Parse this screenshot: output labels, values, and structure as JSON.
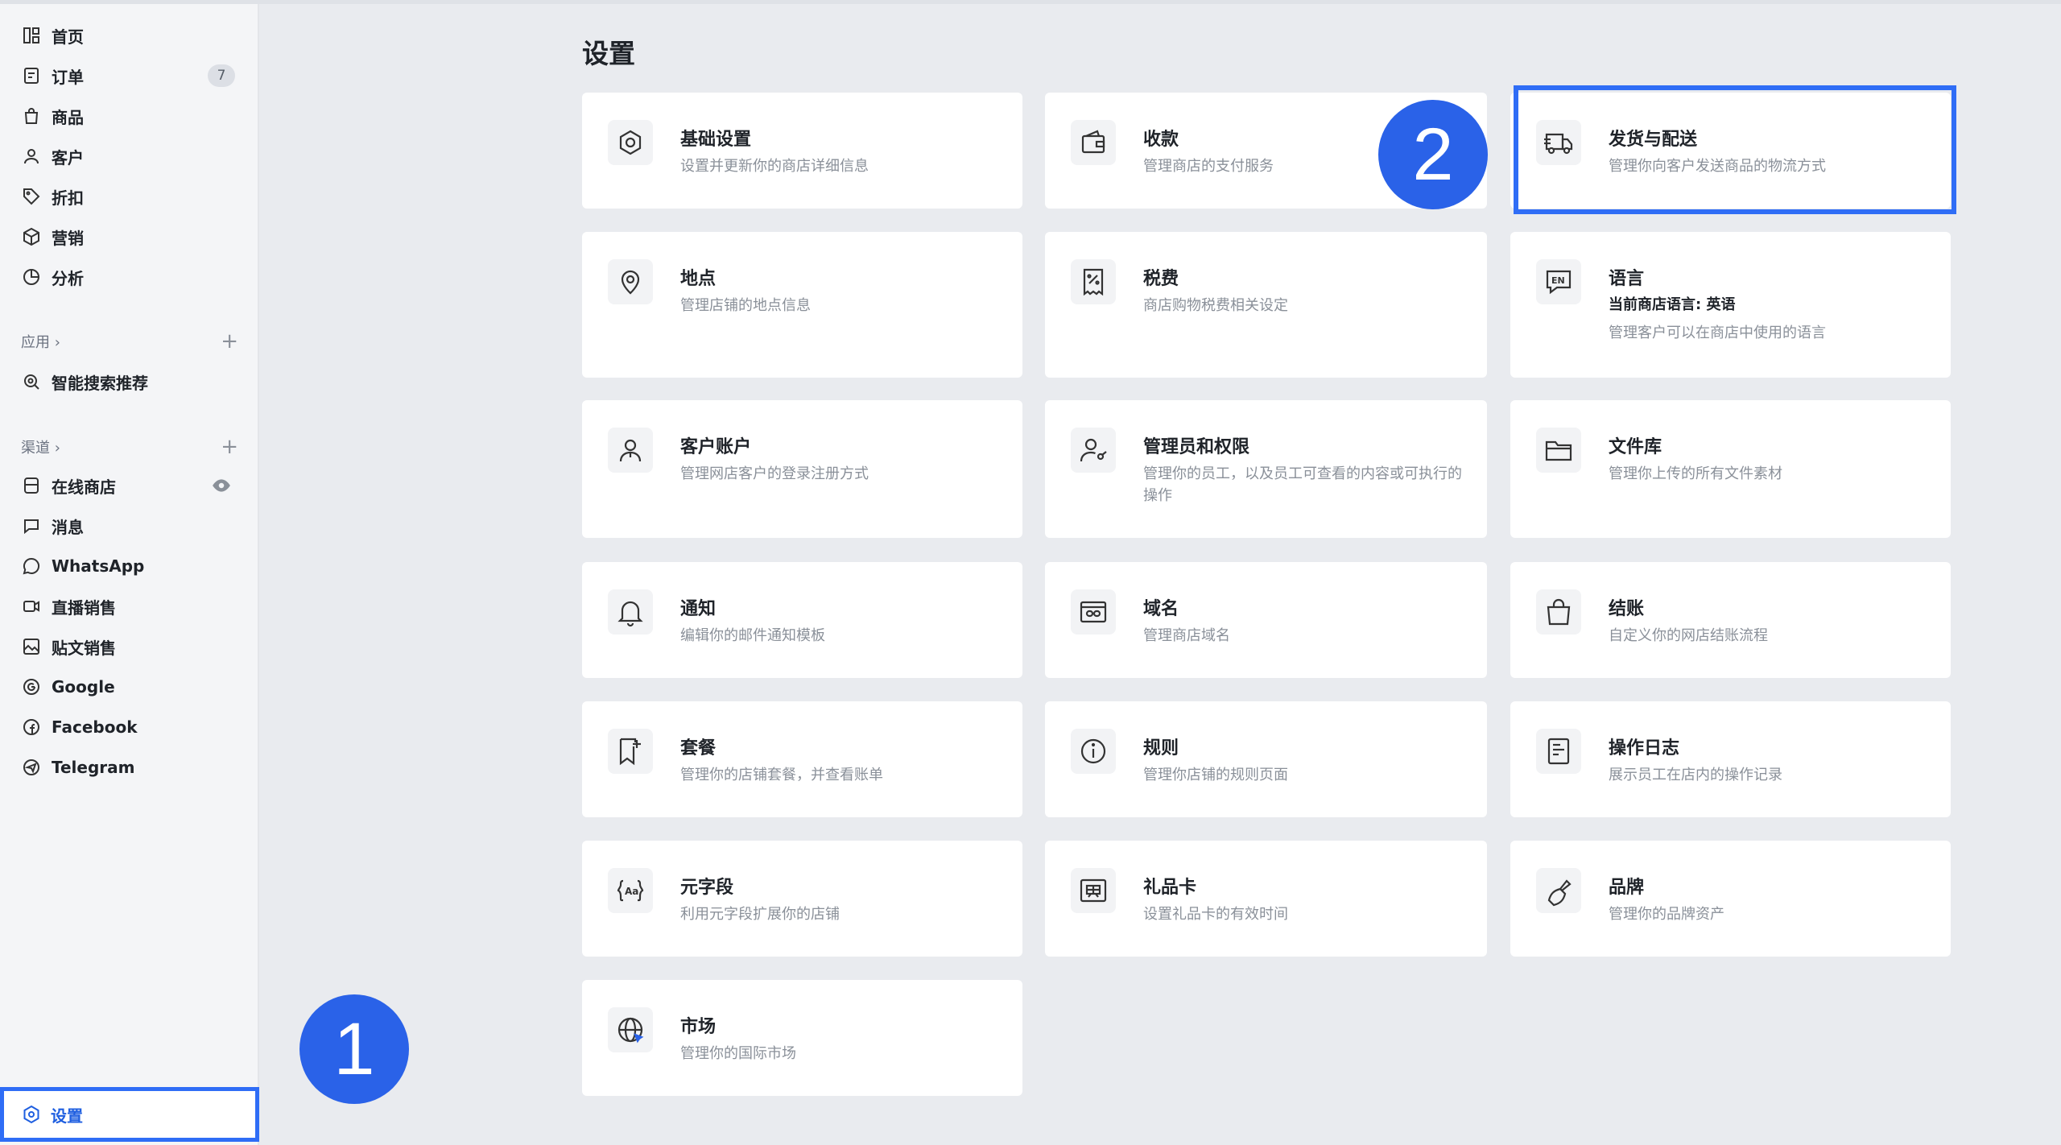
{
  "sidebar": {
    "main_items": [
      {
        "label": "首页",
        "icon": "home-icon"
      },
      {
        "label": "订单",
        "icon": "order-icon",
        "badge": "7"
      },
      {
        "label": "商品",
        "icon": "product-icon"
      },
      {
        "label": "客户",
        "icon": "customer-icon"
      },
      {
        "label": "折扣",
        "icon": "discount-icon"
      },
      {
        "label": "营销",
        "icon": "marketing-icon"
      },
      {
        "label": "分析",
        "icon": "analytics-icon"
      }
    ],
    "apps_heading": "应用 ›",
    "apps_items": [
      {
        "label": "智能搜索推荐",
        "icon": "smart-search-icon"
      }
    ],
    "channels_heading": "渠道 ›",
    "channel_items": [
      {
        "label": "在线商店",
        "icon": "store-icon"
      },
      {
        "label": "消息",
        "icon": "message-icon"
      },
      {
        "label": "WhatsApp",
        "icon": "whatsapp-icon"
      },
      {
        "label": "直播销售",
        "icon": "live-icon"
      },
      {
        "label": "贴文销售",
        "icon": "post-icon"
      },
      {
        "label": "Google",
        "icon": "google-icon"
      },
      {
        "label": "Facebook",
        "icon": "facebook-icon"
      },
      {
        "label": "Telegram",
        "icon": "telegram-icon"
      }
    ],
    "settings_label": "设置"
  },
  "callouts": {
    "one": "1",
    "two": "2"
  },
  "main": {
    "title": "设置",
    "cards": [
      {
        "title": "基础设置",
        "desc": "设置并更新你的商店详细信息",
        "icon": "gear-icon"
      },
      {
        "title": "收款",
        "desc": "管理商店的支付服务",
        "icon": "wallet-icon"
      },
      {
        "title": "发货与配送",
        "desc": "管理你向客户发送商品的物流方式",
        "icon": "truck-icon"
      },
      {
        "title": "地点",
        "desc": "管理店铺的地点信息",
        "icon": "location-icon"
      },
      {
        "title": "税费",
        "desc": "商店购物税费相关设定",
        "icon": "tax-icon"
      },
      {
        "title": "语言",
        "extra": "当前商店语言: 英语",
        "desc": "管理客户可以在商店中使用的语言",
        "icon": "language-icon"
      },
      {
        "title": "客户账户",
        "desc": "管理网店客户的登录注册方式",
        "icon": "account-icon"
      },
      {
        "title": "管理员和权限",
        "desc": "管理你的员工，以及员工可查看的内容或可执行的操作",
        "icon": "admin-icon"
      },
      {
        "title": "文件库",
        "desc": "管理你上传的所有文件素材",
        "icon": "folder-icon"
      },
      {
        "title": "通知",
        "desc": "编辑你的邮件通知模板",
        "icon": "bell-icon"
      },
      {
        "title": "域名",
        "desc": "管理商店域名",
        "icon": "domain-icon"
      },
      {
        "title": "结账",
        "desc": "自定义你的网店结账流程",
        "icon": "checkout-icon"
      },
      {
        "title": "套餐",
        "desc": "管理你的店铺套餐，并查看账单",
        "icon": "plan-icon"
      },
      {
        "title": "规则",
        "desc": "管理你店铺的规则页面",
        "icon": "info-icon"
      },
      {
        "title": "操作日志",
        "desc": "展示员工在店内的操作记录",
        "icon": "log-icon"
      },
      {
        "title": "元字段",
        "desc": "利用元字段扩展你的店铺",
        "icon": "metafield-icon"
      },
      {
        "title": "礼品卡",
        "desc": "设置礼品卡的有效时间",
        "icon": "giftcard-icon"
      },
      {
        "title": "品牌",
        "desc": "管理你的品牌资产",
        "icon": "brand-icon"
      },
      {
        "title": "市场",
        "desc": "管理你的国际市场",
        "icon": "globe-icon"
      }
    ]
  }
}
